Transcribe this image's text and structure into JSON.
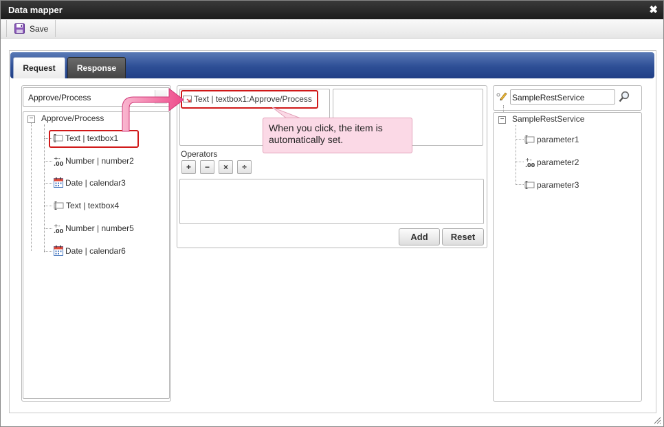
{
  "window": {
    "title": "Data mapper"
  },
  "toolbar": {
    "save_label": "Save"
  },
  "tabs": {
    "request": "Request",
    "response": "Response",
    "active": "request"
  },
  "left_panel": {
    "selected_value": "Approve/Process",
    "tree": {
      "root": "Approve/Process",
      "items": [
        {
          "label": "Text | textbox1",
          "icon": "text-field-icon"
        },
        {
          "label": "Number | number2",
          "icon": "number-icon"
        },
        {
          "label": "Date | calendar3",
          "icon": "calendar-icon"
        },
        {
          "label": "Text | textbox4",
          "icon": "text-field-icon"
        },
        {
          "label": "Number | number5",
          "icon": "number-icon"
        },
        {
          "label": "Date | calendar6",
          "icon": "calendar-icon"
        }
      ]
    }
  },
  "middle_panel": {
    "selected_item": "Text | textbox1:Approve/Process",
    "operators_label": "Operators",
    "operators": [
      "+",
      "−",
      "×",
      "÷"
    ],
    "add_label": "Add",
    "reset_label": "Reset"
  },
  "right_panel": {
    "search_value": "SampleRestService",
    "tree": {
      "root": "SampleRestService",
      "items": [
        {
          "label": "parameter1",
          "icon": "text-field-icon"
        },
        {
          "label": "parameter2",
          "icon": "number-icon"
        },
        {
          "label": "parameter3",
          "icon": "text-field-icon"
        }
      ]
    }
  },
  "annotation": {
    "text": "When you click, the item is automatically set."
  },
  "colors": {
    "title_bar": "#1c1c1c",
    "tab_bar": "#2e4f96",
    "highlight": "#d01818",
    "callout_bg": "#fbd9e6",
    "arrow": "#f04e8c"
  }
}
